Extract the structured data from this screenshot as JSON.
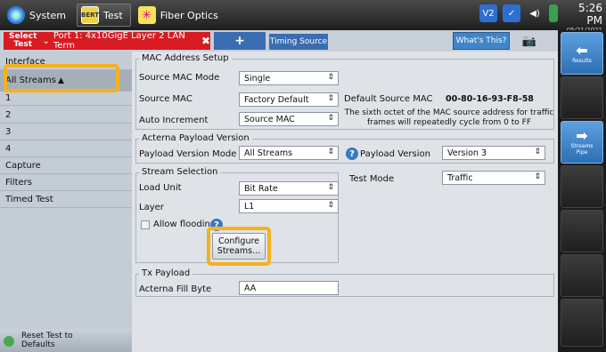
{
  "topbar": {
    "system_label": "System",
    "test_label": "Test",
    "test_icon_text": "BERT",
    "fiber_label": "Fiber Optics",
    "status_v": "V2",
    "time": "5:26 PM",
    "date": "05/21/2021"
  },
  "tabs": {
    "select_test_label": "Select\nTest",
    "port_label": "Port 1: 4x10GigE Layer 2 LAN Term",
    "add_label": "+",
    "timing_label": "Timing Source",
    "whats_this_label": "What's This?"
  },
  "sidebar": {
    "items": [
      {
        "label": "Interface"
      },
      {
        "label": "All Streams"
      },
      {
        "label": "1"
      },
      {
        "label": "2"
      },
      {
        "label": "3"
      },
      {
        "label": "4"
      },
      {
        "label": "Capture"
      },
      {
        "label": "Filters"
      },
      {
        "label": "Timed Test"
      }
    ],
    "reset_label": "Reset Test to Defaults"
  },
  "mac": {
    "section_title": "MAC Address Setup",
    "mode_label": "Source MAC Mode",
    "mode_value": "Single",
    "source_label": "Source MAC",
    "source_value": "Factory Default",
    "default_label": "Default Source MAC",
    "default_value": "00-80-16-93-F8-58",
    "auto_label": "Auto Increment",
    "auto_value": "Source MAC",
    "note": "The sixth octet of the MAC source address for traffic frames will repeatedly cycle from 0 to FF"
  },
  "payload": {
    "section_title": "Acterna Payload Version",
    "mode_label": "Payload Version Mode",
    "mode_value": "All Streams",
    "version_label": "Payload Version",
    "version_value": "Version 3"
  },
  "stream": {
    "section_title": "Stream Selection",
    "load_label": "Load Unit",
    "load_value": "Bit Rate",
    "layer_label": "Layer",
    "layer_value": "L1",
    "flood_label": "Allow flooding",
    "test_mode_label": "Test Mode",
    "test_mode_value": "Traffic",
    "configure_label": "Configure\nStreams..."
  },
  "tx": {
    "section_title": "Tx Payload",
    "fill_label": "Acterna Fill Byte",
    "fill_value": "AA"
  },
  "rightbar": {
    "results_label": "Results",
    "streams_label": "Streams\nPipe"
  },
  "colors": {
    "accent_red": "#d81b22",
    "highlight": "#f5b21b",
    "tab_blue": "#3b6db3"
  }
}
